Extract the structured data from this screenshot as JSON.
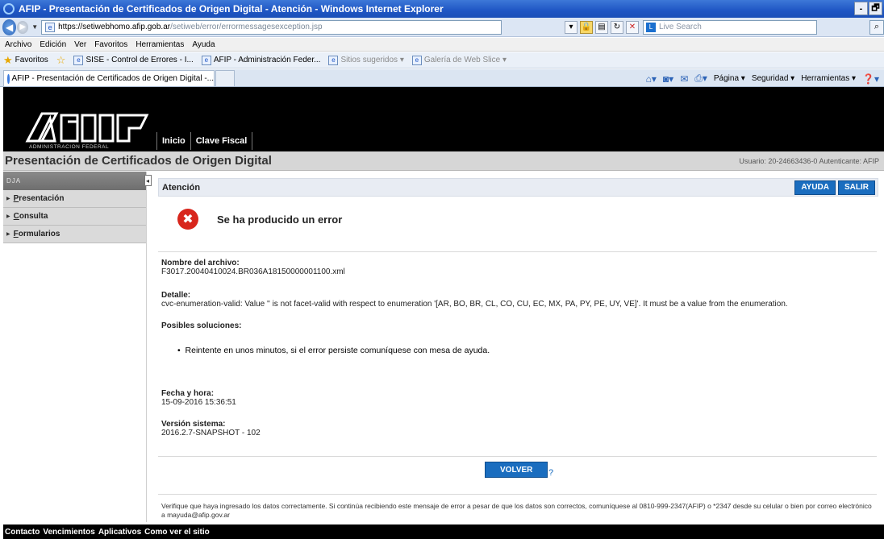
{
  "window": {
    "title": "AFIP - Presentación de Certificados de Origen Digital - Atención - Windows Internet Explorer",
    "min_label": "-",
    "max_label": "🗗"
  },
  "address": {
    "url_host": "https://setiwebhomo.afip.gob.ar",
    "url_path": "/setiweb/error/errormessagesexception.jsp",
    "search_placeholder": "Live Search"
  },
  "menu": [
    "Archivo",
    "Edición",
    "Ver",
    "Favoritos",
    "Herramientas",
    "Ayuda"
  ],
  "favorites": {
    "label": "Favoritos",
    "items": [
      {
        "label": "SISE - Control de Errores - I...",
        "grey": false
      },
      {
        "label": "AFIP - Administración Feder...",
        "grey": false
      },
      {
        "label": "Sitios sugeridos ▾",
        "grey": true
      },
      {
        "label": "Galería de Web Slice ▾",
        "grey": true
      }
    ]
  },
  "tab": {
    "label": "AFIP - Presentación de Certificados de Origen Digital -..."
  },
  "commandbar": {
    "pagina": "Página ▾",
    "seguridad": "Seguridad ▾",
    "herramientas": "Herramientas ▾"
  },
  "header": {
    "logo_subtitle": "ADMINISTRACION FEDERAL",
    "nav": [
      "Inicio",
      "Clave Fiscal"
    ]
  },
  "app": {
    "title": "Presentación de Certificados de Origen Digital",
    "user_info": "Usuario: 20-24663436-0 Autenticante: AFIP"
  },
  "sidebar": {
    "header": "DJA",
    "items": [
      {
        "first": "P",
        "rest": "resentación"
      },
      {
        "first": "C",
        "rest": "onsulta"
      },
      {
        "first": "F",
        "rest": "ormularios"
      }
    ]
  },
  "main": {
    "bar_label": "Atención",
    "help_button": "AYUDA",
    "exit_button": "SALIR",
    "error_title": "Se ha producido un error",
    "file_label": "Nombre del archivo:",
    "file_value": "F3017.20040410024.BR036A18150000001100.xml",
    "detail_label": "Detalle:",
    "detail_value": "cvc-enumeration-valid: Value '' is not facet-valid with respect to enumeration '[AR, BO, BR, CL, CO, CU, EC, MX, PA, PY, PE, UY, VE]'. It must be a value from the enumeration.",
    "solutions_label": "Posibles soluciones:",
    "solution_1": "Reintente en unos minutos, si el error persiste comuníquese con mesa de ayuda.",
    "datetime_label": "Fecha y hora:",
    "datetime_value": "15-09-2016 15:36:51",
    "version_label": "Versión sistema:",
    "version_value": "2016.2.7-SNAPSHOT - 102",
    "back_button": "VOLVER",
    "help_mark": "?",
    "footnote": "Verifique que haya ingresado los datos correctamente. Si continúa recibiendo este mensaje de error a pesar de que los datos son correctos, comuníquese al 0810-999-2347(AFIP) o *2347 desde su celular o bien por correo electrónico a mayuda@afip.gov.ar"
  },
  "footer": {
    "items": [
      "Contacto",
      "Vencimientos",
      "Aplicativos",
      "Como ver el sitio"
    ]
  }
}
